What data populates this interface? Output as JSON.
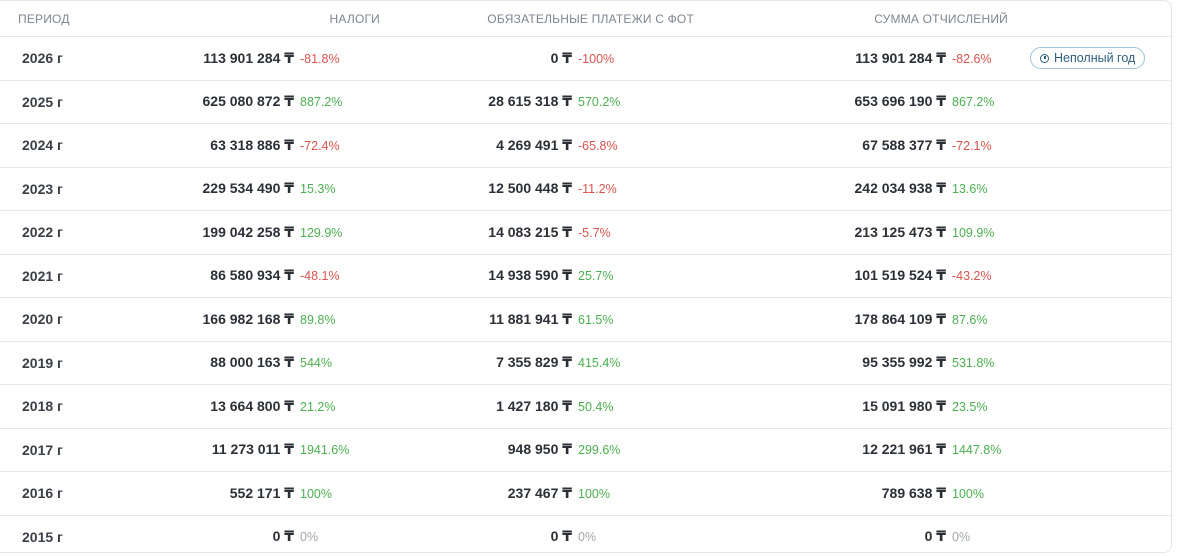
{
  "header": {
    "period": "ПЕРИОД",
    "taxes": "НАЛОГИ",
    "payments": "ОБЯЗАТЕЛЬНЫЕ ПЛАТЕЖИ С ФОТ",
    "total": "СУММА ОТЧИСЛЕНИЙ"
  },
  "currency": "₸",
  "colors": {
    "positive": "#4caf50",
    "negative": "#d9534f",
    "neutral": "#a0a6ad",
    "badge": "#2d5f80"
  },
  "badge": {
    "icon": "info-clock-icon",
    "label": "Неполный год"
  },
  "rows": [
    {
      "period": "2026 г",
      "tax": "113 901 284 ₸",
      "tax_pct": "-81.8%",
      "pay": "0 ₸",
      "pay_pct": "-100%",
      "sum": "113 901 284 ₸",
      "sum_pct": "-82.6%",
      "badge": true
    },
    {
      "period": "2025 г",
      "tax": "625 080 872 ₸",
      "tax_pct": "887.2%",
      "pay": "28 615 318 ₸",
      "pay_pct": "570.2%",
      "sum": "653 696 190 ₸",
      "sum_pct": "867.2%"
    },
    {
      "period": "2024 г",
      "tax": "63 318 886 ₸",
      "tax_pct": "-72.4%",
      "pay": "4 269 491 ₸",
      "pay_pct": "-65.8%",
      "sum": "67 588 377 ₸",
      "sum_pct": "-72.1%"
    },
    {
      "period": "2023 г",
      "tax": "229 534 490 ₸",
      "tax_pct": "15.3%",
      "pay": "12 500 448 ₸",
      "pay_pct": "-11.2%",
      "sum": "242 034 938 ₸",
      "sum_pct": "13.6%"
    },
    {
      "period": "2022 г",
      "tax": "199 042 258 ₸",
      "tax_pct": "129.9%",
      "pay": "14 083 215 ₸",
      "pay_pct": "-5.7%",
      "sum": "213 125 473 ₸",
      "sum_pct": "109.9%"
    },
    {
      "period": "2021 г",
      "tax": "86 580 934 ₸",
      "tax_pct": "-48.1%",
      "pay": "14 938 590 ₸",
      "pay_pct": "25.7%",
      "sum": "101 519 524 ₸",
      "sum_pct": "-43.2%"
    },
    {
      "period": "2020 г",
      "tax": "166 982 168 ₸",
      "tax_pct": "89.8%",
      "pay": "11 881 941 ₸",
      "pay_pct": "61.5%",
      "sum": "178 864 109 ₸",
      "sum_pct": "87.6%"
    },
    {
      "period": "2019 г",
      "tax": "88 000 163 ₸",
      "tax_pct": "544%",
      "pay": "7 355 829 ₸",
      "pay_pct": "415.4%",
      "sum": "95 355 992 ₸",
      "sum_pct": "531.8%"
    },
    {
      "period": "2018 г",
      "tax": "13 664 800 ₸",
      "tax_pct": "21.2%",
      "pay": "1 427 180 ₸",
      "pay_pct": "50.4%",
      "sum": "15 091 980 ₸",
      "sum_pct": "23.5%"
    },
    {
      "period": "2017 г",
      "tax": "11 273 011 ₸",
      "tax_pct": "1941.6%",
      "pay": "948 950 ₸",
      "pay_pct": "299.6%",
      "sum": "12 221 961 ₸",
      "sum_pct": "1447.8%"
    },
    {
      "period": "2016 г",
      "tax": "552 171 ₸",
      "tax_pct": "100%",
      "pay": "237 467 ₸",
      "pay_pct": "100%",
      "sum": "789 638 ₸",
      "sum_pct": "100%"
    },
    {
      "period": "2015 г",
      "tax": "0 ₸",
      "tax_pct": "0%",
      "pay": "0 ₸",
      "pay_pct": "0%",
      "sum": "0 ₸",
      "sum_pct": "0%"
    }
  ]
}
